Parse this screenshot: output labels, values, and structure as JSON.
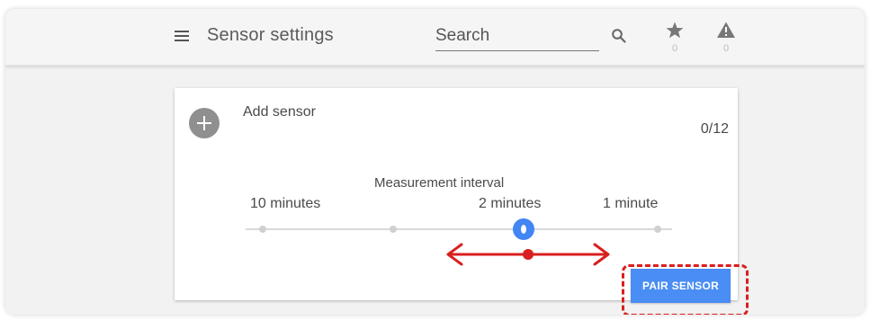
{
  "header": {
    "title": "Sensor settings",
    "search_placeholder": "Search",
    "search_icon": "search-icon",
    "menu_icon": "menu-icon",
    "actions": [
      {
        "name": "star",
        "icon": "star-icon",
        "count": "0"
      },
      {
        "name": "alert",
        "icon": "warning-icon",
        "count": "0"
      }
    ]
  },
  "card": {
    "add_label": "Add sensor",
    "add_icon": "plus-icon",
    "count": "0/12",
    "interval_label": "Measurement interval",
    "slider": {
      "labels": [
        "10 minutes",
        "2 minutes",
        "1 minute"
      ],
      "steps": 4,
      "selected_step": 3,
      "selected_label": "2 minutes"
    },
    "pair_button_label": "PAIR SENSOR"
  },
  "annotations": {
    "arrow_icon": "double-arrow-icon",
    "arrow_color": "#d91f1f",
    "highlight_color": "#d91f1f"
  },
  "colors": {
    "accent": "#4a8df4",
    "thumb": "#4285f4",
    "text": "#4a4a4a"
  }
}
